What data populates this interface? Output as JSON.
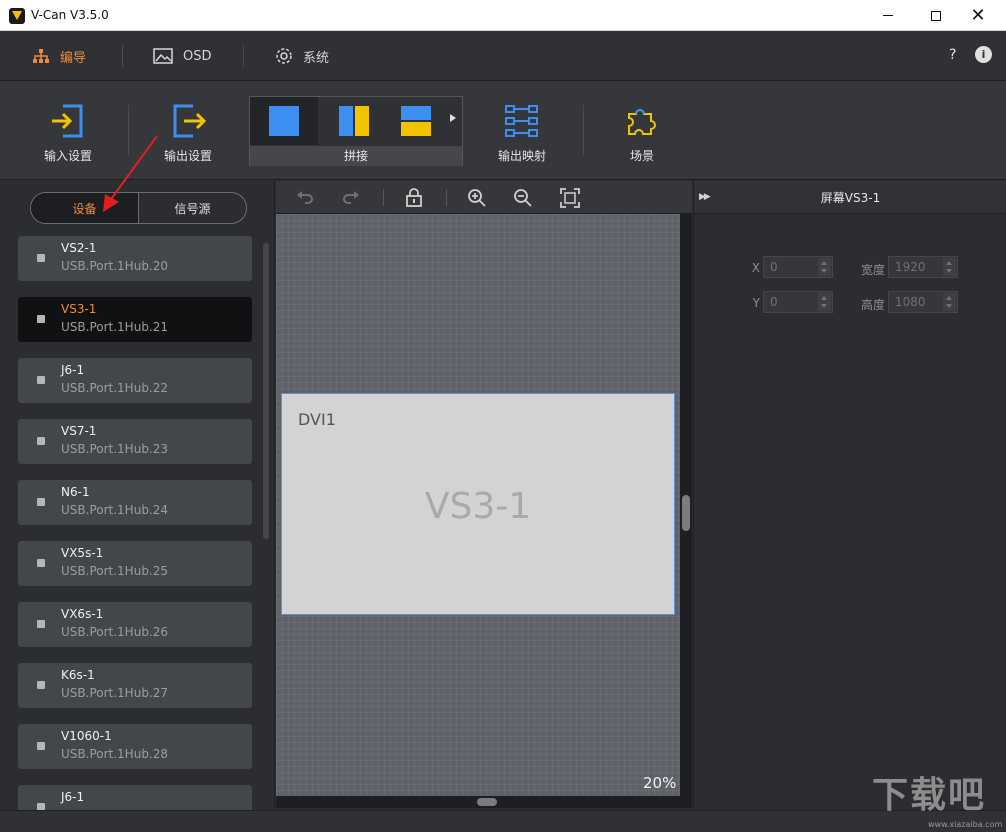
{
  "window": {
    "title": "V-Can V3.5.0",
    "close_glyph": "✕"
  },
  "topnav": {
    "items": [
      {
        "label": "编导",
        "icon": "hierarchy-icon"
      },
      {
        "label": "OSD",
        "icon": "image-icon"
      },
      {
        "label": "系统",
        "icon": "gear-icon"
      }
    ],
    "help": "?",
    "info": "i"
  },
  "toolbar": {
    "input_settings": "输入设置",
    "output_settings": "输出设置",
    "splice": "拼接",
    "output_mapping": "输出映射",
    "scene": "场景"
  },
  "left": {
    "tabs": {
      "devices": "设备",
      "sources": "信号源"
    },
    "devices": [
      {
        "name": "VS2-1",
        "port": "USB.Port.1Hub.20",
        "selected": false
      },
      {
        "name": "VS3-1",
        "port": "USB.Port.1Hub.21",
        "selected": true
      },
      {
        "name": "J6-1",
        "port": "USB.Port.1Hub.22",
        "selected": false
      },
      {
        "name": "VS7-1",
        "port": "USB.Port.1Hub.23",
        "selected": false
      },
      {
        "name": "N6-1",
        "port": "USB.Port.1Hub.24",
        "selected": false
      },
      {
        "name": "VX5s-1",
        "port": "USB.Port.1Hub.25",
        "selected": false
      },
      {
        "name": "VX6s-1",
        "port": "USB.Port.1Hub.26",
        "selected": false
      },
      {
        "name": "K6s-1",
        "port": "USB.Port.1Hub.27",
        "selected": false
      },
      {
        "name": "V1060-1",
        "port": "USB.Port.1Hub.28",
        "selected": false
      },
      {
        "name": "J6-1",
        "port": "",
        "selected": false
      }
    ]
  },
  "canvas": {
    "screen_port": "DVI1",
    "screen_name": "VS3-1",
    "zoom": "20%"
  },
  "right": {
    "title": "屏幕VS3-1",
    "x_label": "X",
    "x_value": "0",
    "y_label": "Y",
    "y_value": "0",
    "width_label": "宽度",
    "width_value": "1920",
    "height_label": "高度",
    "height_value": "1080"
  },
  "watermark": {
    "text": "下载吧",
    "url": "www.xiazaiba.com"
  },
  "colors": {
    "accent": "#f08a3c",
    "blue": "#3d8ef0",
    "yellow": "#f2c300",
    "annotation": "#e02020"
  }
}
